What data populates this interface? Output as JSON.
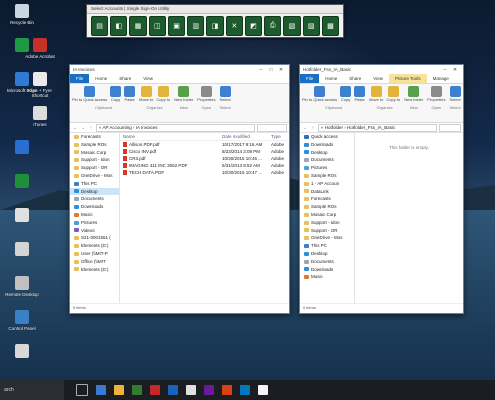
{
  "floating_toolbar": {
    "title": "Select Accounts | Single Sign-On Utility",
    "buttons": [
      "b1",
      "b2",
      "b3",
      "b4",
      "b5",
      "b6",
      "b7",
      "b8",
      "b9",
      "b10",
      "b11",
      "b12",
      "b13"
    ]
  },
  "desktop_icons": [
    {
      "label": "Recycle Bin",
      "color": "#c9d5e0"
    },
    {
      "label": "",
      "color": "#1e9a45"
    },
    {
      "label": "Adobe Acrobat",
      "color": "#c8302a"
    },
    {
      "label": "Microsoft Edge",
      "color": "#2e7bd6"
    },
    {
      "label": "Kore + Fyre Shortcut",
      "color": "#e9e9e9"
    },
    {
      "label": "iTunes",
      "color": "#dcdcdc"
    },
    {
      "label": "",
      "color": "#2a6fd0"
    },
    {
      "label": "",
      "color": "#1f8f3c"
    },
    {
      "label": "",
      "color": "#e0e0e0"
    },
    {
      "label": "",
      "color": "#d4d4d4"
    },
    {
      "label": "Remote Desktop",
      "color": "#c0c0c0"
    },
    {
      "label": "Control Panel",
      "color": "#3b7fc4"
    },
    {
      "label": "",
      "color": "#d8d8d8"
    }
  ],
  "left_window": {
    "title": "IA Invoices",
    "tabs": [
      "File",
      "Home",
      "Share",
      "View"
    ],
    "ribbon_groups": [
      {
        "name": "Clipboard",
        "items": [
          "Pin to Quick access",
          "Copy",
          "Paste"
        ]
      },
      {
        "name": "Organize",
        "items": [
          "Move to",
          "Copy to"
        ]
      },
      {
        "name": "New",
        "items": [
          "New folder"
        ]
      },
      {
        "name": "Open",
        "items": [
          "Properties"
        ]
      },
      {
        "name": "Select",
        "items": [
          "Select"
        ]
      }
    ],
    "path": "« AP Accounting › IA Invoices",
    "nav": [
      {
        "label": "Forecasts",
        "sel": false
      },
      {
        "label": "Sample ROs",
        "sel": false
      },
      {
        "label": "Mosaic Corp",
        "sel": false
      },
      {
        "label": "Support - Idon",
        "sel": false
      },
      {
        "label": "Support - OR",
        "sel": false
      },
      {
        "label": "OneDrive - Mos",
        "sel": false
      },
      {
        "label": "This PC",
        "sel": false
      },
      {
        "label": "Desktop",
        "sel": true
      },
      {
        "label": "Documents",
        "sel": false
      },
      {
        "label": "Downloads",
        "sel": false
      },
      {
        "label": "Music",
        "sel": false
      },
      {
        "label": "Pictures",
        "sel": false
      },
      {
        "label": "Videos",
        "sel": false
      },
      {
        "label": "S21-0001551 (",
        "sel": false
      },
      {
        "label": "Elements (D:)",
        "sel": false
      },
      {
        "label": "User (\\\\MIT-P",
        "sel": false
      },
      {
        "label": "Office (\\\\MIT",
        "sel": false
      },
      {
        "label": "Elements (D:)",
        "sel": false
      }
    ],
    "columns": [
      "Name",
      "Date modified",
      "Type"
    ],
    "files": [
      {
        "name": "Allison.PDF.pdf",
        "date": "10/17/2017 9:16 AM",
        "type": "Adobe"
      },
      {
        "name": "Cisco INV.pdf",
        "date": "8/23/2014 3:08 PM",
        "type": "Adobe"
      },
      {
        "name": "CR3.pdf",
        "date": "10/30/2015 10:45 ...",
        "type": "Adobe"
      },
      {
        "name": "IMAGING 411 INC 3052.PDF",
        "date": "5/31/2013 8:52 AM",
        "type": "Adobe"
      },
      {
        "name": "TECH DATA.PDF",
        "date": "10/30/2015 10:47 ...",
        "type": "Adobe"
      }
    ],
    "status": "5 items"
  },
  "right_window": {
    "title": "Hotfolder_Fss_IA_Basic",
    "context_tab": "Picture Tools",
    "tabs": [
      "File",
      "Home",
      "Share",
      "View",
      "Manage"
    ],
    "ribbon_groups": [
      {
        "name": "Clipboard",
        "items": [
          "Pin to Quick access",
          "Copy",
          "Paste"
        ]
      },
      {
        "name": "Organize",
        "items": [
          "Move to",
          "Copy to"
        ]
      },
      {
        "name": "New",
        "items": [
          "New folder"
        ]
      },
      {
        "name": "Open",
        "items": [
          "Properties"
        ]
      },
      {
        "name": "Select",
        "items": [
          "Select"
        ]
      }
    ],
    "path": "« Hotfolder › Hotfolder_Fss_IA_Basic",
    "empty_message": "This folder is empty.",
    "nav": [
      {
        "label": "Quick access",
        "sel": false
      },
      {
        "label": "Downloads",
        "sel": false
      },
      {
        "label": "Desktop",
        "sel": false
      },
      {
        "label": "Documents",
        "sel": false
      },
      {
        "label": "Pictures",
        "sel": false
      },
      {
        "label": "Sample ROs",
        "sel": false
      },
      {
        "label": "1 - AP Accoun",
        "sel": false
      },
      {
        "label": "DataLink",
        "sel": false
      },
      {
        "label": "Forecasts",
        "sel": false
      },
      {
        "label": "Sample ROs",
        "sel": false
      },
      {
        "label": "Mosaic Corp",
        "sel": false
      },
      {
        "label": "Support - Idon",
        "sel": false
      },
      {
        "label": "Support - OR",
        "sel": false
      },
      {
        "label": "OneDrive - Mos",
        "sel": false
      },
      {
        "label": "This PC",
        "sel": false
      },
      {
        "label": "Desktop",
        "sel": false
      },
      {
        "label": "Documents",
        "sel": false
      },
      {
        "label": "Downloads",
        "sel": false
      },
      {
        "label": "Music",
        "sel": false
      }
    ],
    "status": "0 items"
  },
  "taskbar": {
    "search_text": "arch",
    "apps": [
      "#3a7bd5",
      "#f0b23a",
      "#2e7d32",
      "#c62828",
      "#1565c0",
      "#e0e0e0",
      "#6a1b9a",
      "#d84315",
      "#0277bd",
      "#f5f5f5"
    ]
  }
}
